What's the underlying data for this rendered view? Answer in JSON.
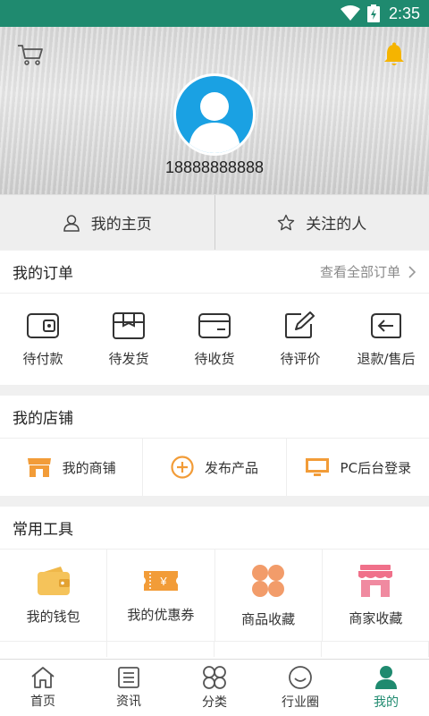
{
  "status_bar": {
    "time": "2:35"
  },
  "header": {
    "phone": "18888888888"
  },
  "profile_links": [
    {
      "label": "我的主页",
      "icon": "user-icon"
    },
    {
      "label": "关注的人",
      "icon": "star-icon"
    }
  ],
  "orders": {
    "title": "我的订单",
    "view_all": "查看全部订单",
    "items": [
      {
        "label": "待付款",
        "icon": "wallet-icon"
      },
      {
        "label": "待发货",
        "icon": "package-icon"
      },
      {
        "label": "待收货",
        "icon": "card-icon"
      },
      {
        "label": "待评价",
        "icon": "edit-icon"
      },
      {
        "label": "退款/售后",
        "icon": "return-icon"
      }
    ]
  },
  "shop": {
    "title": "我的店铺",
    "items": [
      {
        "label": "我的商铺",
        "icon": "storefront-icon"
      },
      {
        "label": "发布产品",
        "icon": "plus-circle-icon"
      },
      {
        "label": "PC后台登录",
        "icon": "monitor-icon"
      }
    ]
  },
  "tools": {
    "title": "常用工具",
    "items": [
      {
        "label": "我的钱包",
        "icon": "wallet-icon"
      },
      {
        "label": "我的优惠券",
        "icon": "coupon-icon"
      },
      {
        "label": "商品收藏",
        "icon": "clover-icon"
      },
      {
        "label": "商家收藏",
        "icon": "store-icon"
      }
    ]
  },
  "tabbar": {
    "items": [
      {
        "label": "首页",
        "icon": "home-icon",
        "active": false
      },
      {
        "label": "资讯",
        "icon": "news-icon",
        "active": false
      },
      {
        "label": "分类",
        "icon": "category-icon",
        "active": false
      },
      {
        "label": "行业圈",
        "icon": "smile-icon",
        "active": false
      },
      {
        "label": "我的",
        "icon": "person-icon",
        "active": true
      }
    ]
  },
  "colors": {
    "brand": "#1f8a6f",
    "accent_orange": "#f29c38",
    "bell": "#f5b400",
    "avatar_blue": "#1aa1e3",
    "store_pink": "#f0708a"
  }
}
